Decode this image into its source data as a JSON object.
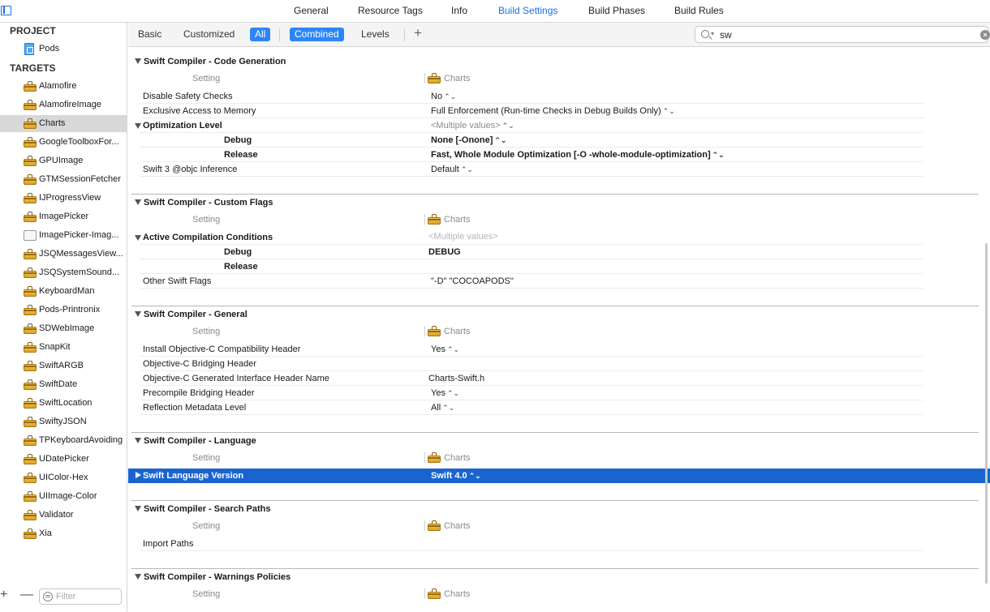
{
  "tabs": {
    "general": "General",
    "resource_tags": "Resource Tags",
    "info": "Info",
    "build_settings": "Build Settings",
    "build_phases": "Build Phases",
    "build_rules": "Build Rules"
  },
  "sidebar": {
    "project_header": "PROJECT",
    "project_name": "Pods",
    "targets_header": "TARGETS",
    "targets": [
      "Alamofire",
      "AlamofireImage",
      "Charts",
      "GoogleToolboxFor...",
      "GPUImage",
      "GTMSessionFetcher",
      "IJProgressView",
      "ImagePicker",
      "ImagePicker-Imag...",
      "JSQMessagesView...",
      "JSQSystemSound...",
      "KeyboardMan",
      "Pods-Printronix",
      "SDWebImage",
      "SnapKit",
      "SwiftARGB",
      "SwiftDate",
      "SwiftLocation",
      "SwiftyJSON",
      "TPKeyboardAvoiding",
      "UDatePicker",
      "UIColor-Hex",
      "UIImage-Color",
      "Validator",
      "Xia"
    ],
    "selected_target": "Charts",
    "add_label": "+",
    "remove_label": "—",
    "filter_placeholder": "Filter"
  },
  "toolbar": {
    "basic": "Basic",
    "customized": "Customized",
    "all": "All",
    "combined": "Combined",
    "levels": "Levels",
    "add": "+",
    "search_value": "sw"
  },
  "columns": {
    "setting": "Setting",
    "target": "Charts"
  },
  "sections": {
    "codegen": {
      "title": "Swift Compiler - Code Generation",
      "rows": {
        "disable_safety": {
          "name": "Disable Safety Checks",
          "value": "No"
        },
        "exclusive_access": {
          "name": "Exclusive Access to Memory",
          "value": "Full Enforcement (Run-time Checks in Debug Builds Only)"
        },
        "optimization": {
          "name": "Optimization Level",
          "value": "<Multiple values>"
        },
        "opt_debug": {
          "name": "Debug",
          "value": "None [-Onone]"
        },
        "opt_release": {
          "name": "Release",
          "value": "Fast, Whole Module Optimization  [-O -whole-module-optimization]"
        },
        "objc_inference": {
          "name": "Swift 3 @objc Inference",
          "value": "Default"
        }
      }
    },
    "custom_flags": {
      "title": "Swift Compiler - Custom Flags",
      "rows": {
        "active_conditions": {
          "name": "Active Compilation Conditions",
          "value": "<Multiple values>"
        },
        "acc_debug": {
          "name": "Debug",
          "value": "DEBUG"
        },
        "acc_release": {
          "name": "Release",
          "value": ""
        },
        "other_flags": {
          "name": "Other Swift Flags",
          "value": "\"-D\" \"COCOAPODS\""
        }
      }
    },
    "general": {
      "title": "Swift Compiler - General",
      "rows": {
        "install_header": {
          "name": "Install Objective-C Compatibility Header",
          "value": "Yes"
        },
        "bridging_header": {
          "name": "Objective-C Bridging Header",
          "value": ""
        },
        "generated_header": {
          "name": "Objective-C Generated Interface Header Name",
          "value": "Charts-Swift.h"
        },
        "precompile": {
          "name": "Precompile Bridging Header",
          "value": "Yes"
        },
        "reflection": {
          "name": "Reflection Metadata Level",
          "value": "All"
        }
      }
    },
    "language": {
      "title": "Swift Compiler - Language",
      "rows": {
        "swift_version": {
          "name": "Swift Language Version",
          "value": "Swift 4.0"
        }
      }
    },
    "search_paths": {
      "title": "Swift Compiler - Search Paths",
      "rows": {
        "import_paths": {
          "name": "Import Paths",
          "value": ""
        }
      }
    },
    "warnings": {
      "title": "Swift Compiler - Warnings Policies"
    }
  },
  "stepper_glyph": "⌃⌄",
  "colors": {
    "accent": "#2d86f5",
    "selection": "#1a64cf",
    "active_tab": "#1a6ee6"
  }
}
